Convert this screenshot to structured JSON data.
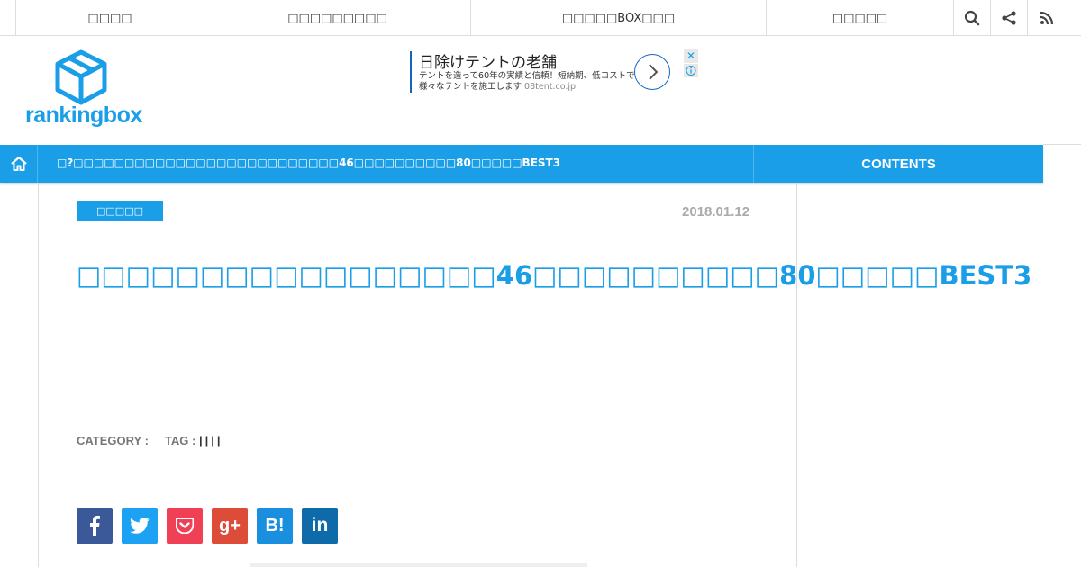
{
  "topnav": {
    "items": [
      {
        "label": "□□□□"
      },
      {
        "label": "□□□□□□□□□"
      },
      {
        "label": "□□□□□BOX□□□"
      },
      {
        "label": "□□□□□"
      }
    ],
    "icons": [
      "search-icon",
      "share-icon",
      "rss-icon"
    ]
  },
  "header": {
    "logo_text": "rankingbox"
  },
  "ad": {
    "title": "日除けテントの老舗",
    "description": "テントを造って60年の実績と信頼！短納期、低コストで様々なテントを施工します",
    "url": "08tent.co.jp",
    "close_label": "✕"
  },
  "bluebar": {
    "breadcrumb": "□?□□□□□□□□□□□□□□□□□□□□□□□□□□46□□□□□□□□□□80□□□□□BEST3",
    "contents_label": "CONTENTS"
  },
  "article": {
    "category_badge": "□□□□□",
    "date": "2018.01.12",
    "title": "□□□□□□□□□□□□□□□□□46□□□□□□□□□□80□□□□□BEST3",
    "category_label": "CATEGORY :",
    "tag_label": "TAG :",
    "tags": "||||"
  },
  "share": {
    "buttons": [
      {
        "name": "facebook",
        "glyph": "f",
        "color": "#3b5998"
      },
      {
        "name": "twitter",
        "glyph": "t",
        "color": "#1da1f2"
      },
      {
        "name": "pocket",
        "glyph": "p",
        "color": "#ef4056"
      },
      {
        "name": "googleplus",
        "glyph": "g+",
        "color": "#dd4b39"
      },
      {
        "name": "hatena",
        "glyph": "B!",
        "color": "#1a8fe0"
      },
      {
        "name": "linkedin",
        "glyph": "in",
        "color": "#0e6aa8"
      }
    ]
  },
  "colors": {
    "accent": "#1a9ee8",
    "meta_gray": "#777777",
    "date_gray": "#aaaaaa"
  }
}
